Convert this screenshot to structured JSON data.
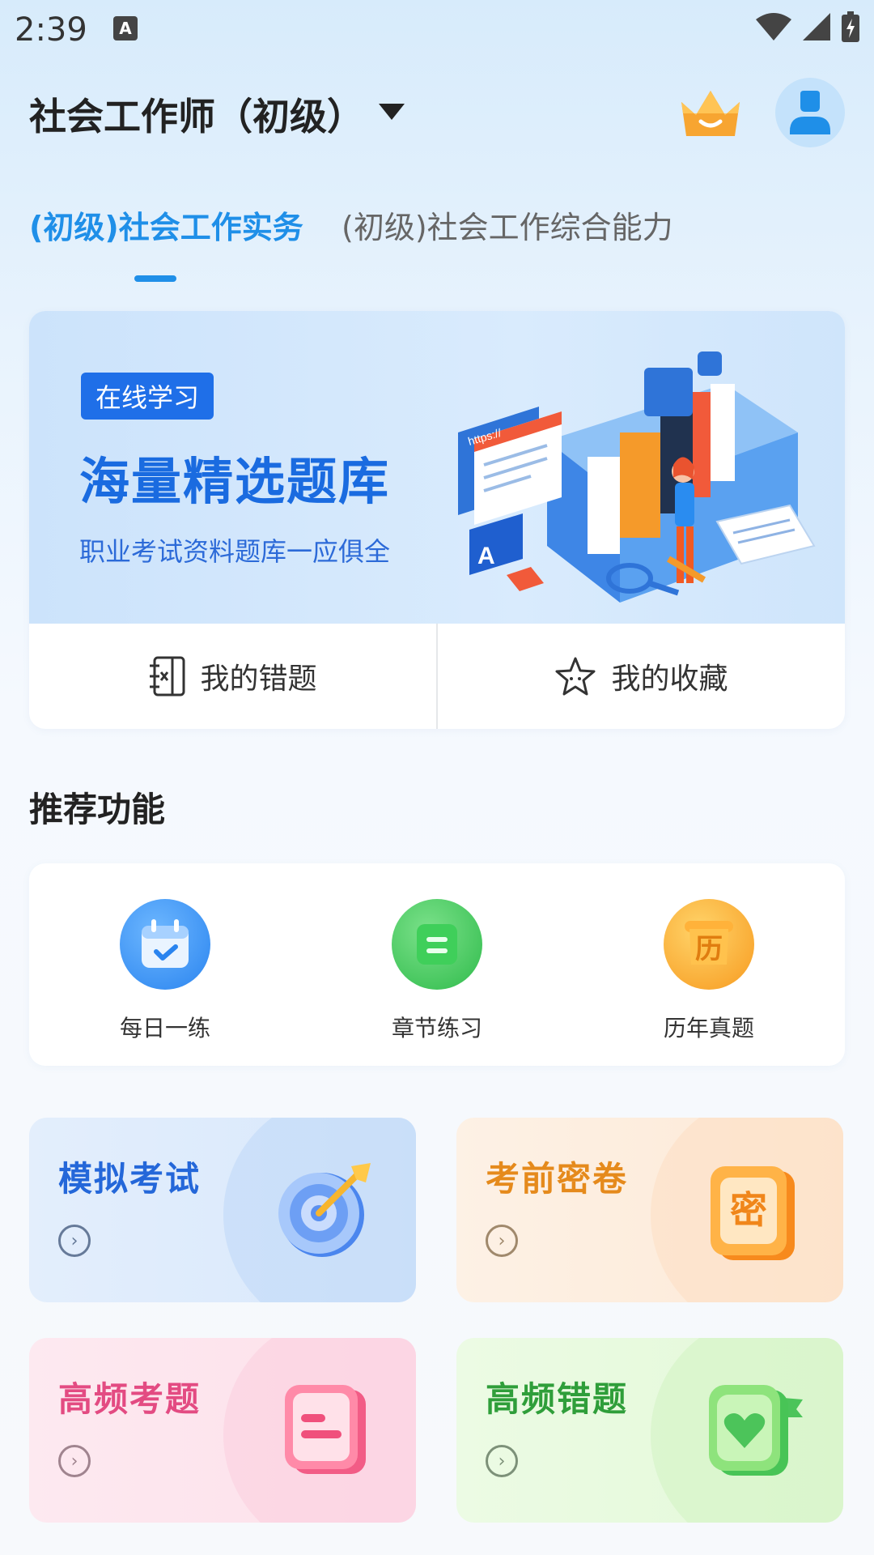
{
  "status_bar": {
    "time": "2:39",
    "a_badge": "A"
  },
  "header": {
    "exam_title": "社会工作师（初级）"
  },
  "tabs": [
    {
      "label": "(初级)社会工作实务",
      "active": true
    },
    {
      "label": "(初级)社会工作综合能力",
      "active": false
    }
  ],
  "banner": {
    "tag": "在线学习",
    "title": "海量精选题库",
    "subtitle": "职业考试资料题库一应俱全",
    "illustration_text": "https://"
  },
  "quick_links": [
    {
      "label": "我的错题",
      "icon": "wrong-questions-icon"
    },
    {
      "label": "我的收藏",
      "icon": "star-icon"
    }
  ],
  "recommend": {
    "title": "推荐功能",
    "items": [
      {
        "label": "每日一练",
        "icon": "calendar-icon"
      },
      {
        "label": "章节练习",
        "icon": "chapter-icon"
      },
      {
        "label": "历年真题",
        "icon": "past-papers-icon",
        "icon_char": "历"
      }
    ]
  },
  "features": [
    {
      "title": "模拟考试",
      "icon": "target-icon"
    },
    {
      "title": "考前密卷",
      "icon": "secret-paper-icon",
      "icon_char": "密"
    },
    {
      "title": "高频考题",
      "icon": "frequent-questions-icon"
    },
    {
      "title": "高频错题",
      "icon": "heart-book-icon"
    }
  ],
  "colors": {
    "accent": "#1f8fe8",
    "banner_title": "#1a6be0",
    "mock_exam": "#2467d9",
    "secret_paper": "#e58a1c",
    "frequent_questions": "#e34b82",
    "frequent_wrong": "#2f9e3a"
  }
}
